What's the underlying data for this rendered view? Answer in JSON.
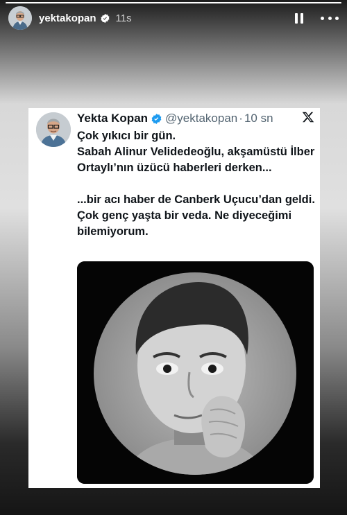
{
  "story": {
    "username": "yektakopan",
    "time_ago": "11s",
    "progress": 1.0
  },
  "tweet": {
    "display_name": "Yekta Kopan",
    "handle": "@yektakopan",
    "separator": "·",
    "time_ago": "10 sn",
    "lines": [
      "Çok yıkıcı bir gün.",
      "Sabah Alinur Velidedeoğlu, akşamüstü İlber Ortaylı’nın üzücü haberleri derken...",
      "",
      "...bir acı haber de Canberk Uçucu’dan geldi. Çok genç yaşta bir veda. Ne diyeceğimi bilemiyorum."
    ]
  },
  "icons": {
    "verified": "verified-badge-icon",
    "pause": "pause-icon",
    "more": "more-horizontal-icon",
    "x": "x-logo-icon"
  },
  "colors": {
    "verified_blue": "#1d9bf0",
    "tweet_text": "#0f1419",
    "tweet_meta": "#536471"
  }
}
